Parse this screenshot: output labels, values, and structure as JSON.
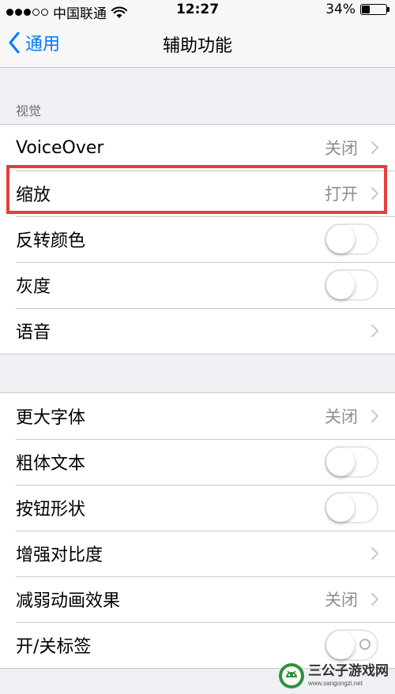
{
  "status_bar": {
    "carrier": "中国联通",
    "time": "12:27",
    "battery_percent": "34%",
    "battery_level": 0.34,
    "signal_filled": 3,
    "signal_total": 5
  },
  "nav": {
    "back_label": "通用",
    "title": "辅助功能"
  },
  "section_vision": {
    "header": "视觉"
  },
  "group1": [
    {
      "label": "VoiceOver",
      "value": "关闭",
      "type": "disclosure"
    },
    {
      "label": "缩放",
      "value": "打开",
      "type": "disclosure",
      "highlighted": true
    },
    {
      "label": "反转颜色",
      "type": "toggle",
      "on": false
    },
    {
      "label": "灰度",
      "type": "toggle",
      "on": false
    },
    {
      "label": "语音",
      "type": "disclosure"
    }
  ],
  "group2": [
    {
      "label": "更大字体",
      "value": "关闭",
      "type": "disclosure"
    },
    {
      "label": "粗体文本",
      "type": "toggle",
      "on": false
    },
    {
      "label": "按钮形状",
      "type": "toggle",
      "on": false
    },
    {
      "label": "增强对比度",
      "type": "disclosure"
    },
    {
      "label": "减弱动画效果",
      "value": "关闭",
      "type": "disclosure"
    },
    {
      "label": "开/关标签",
      "type": "toggle",
      "on": false
    }
  ],
  "watermark": {
    "name": "三公子游戏网",
    "url": "www.sangongzi.net"
  },
  "colors": {
    "accent": "#007aff",
    "highlight_border": "#e53e3e",
    "background": "#efeff4"
  }
}
